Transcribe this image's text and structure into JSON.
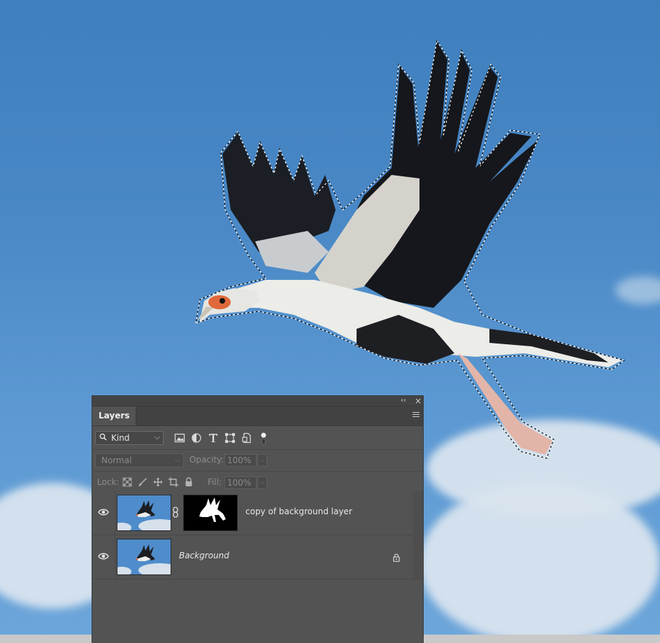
{
  "panel": {
    "collapse_glyph": "‹‹",
    "close_glyph": "×",
    "tab_label": "Layers",
    "menu_icon": "panel-menu-icon"
  },
  "filter": {
    "kind_label": "Kind",
    "kind_chevron": "⌵",
    "filter_icons": [
      "pixel-layer-filter-icon",
      "adjustment-layer-filter-icon",
      "type-layer-filter-icon",
      "shape-layer-filter-icon",
      "smart-object-filter-icon",
      "filter-toggle-icon"
    ]
  },
  "blend": {
    "mode": "Normal",
    "opacity_label": "Opacity:",
    "opacity_value": "100%"
  },
  "lock": {
    "label": "Lock:",
    "fill_label": "Fill:",
    "fill_value": "100%",
    "icons": [
      "lock-transparent-pixels-icon",
      "lock-image-pixels-icon",
      "lock-position-icon",
      "lock-artboard-icon",
      "lock-all-icon"
    ]
  },
  "layers": [
    {
      "name": "copy of background layer",
      "visible": true,
      "has_mask": true,
      "locked": false,
      "italic": false
    },
    {
      "name": "Background",
      "visible": true,
      "has_mask": false,
      "locked": true,
      "italic": true
    }
  ],
  "colors": {
    "panel_bg": "#535353",
    "sky": "#4a88c6",
    "cloud": "#d9e4ef"
  }
}
